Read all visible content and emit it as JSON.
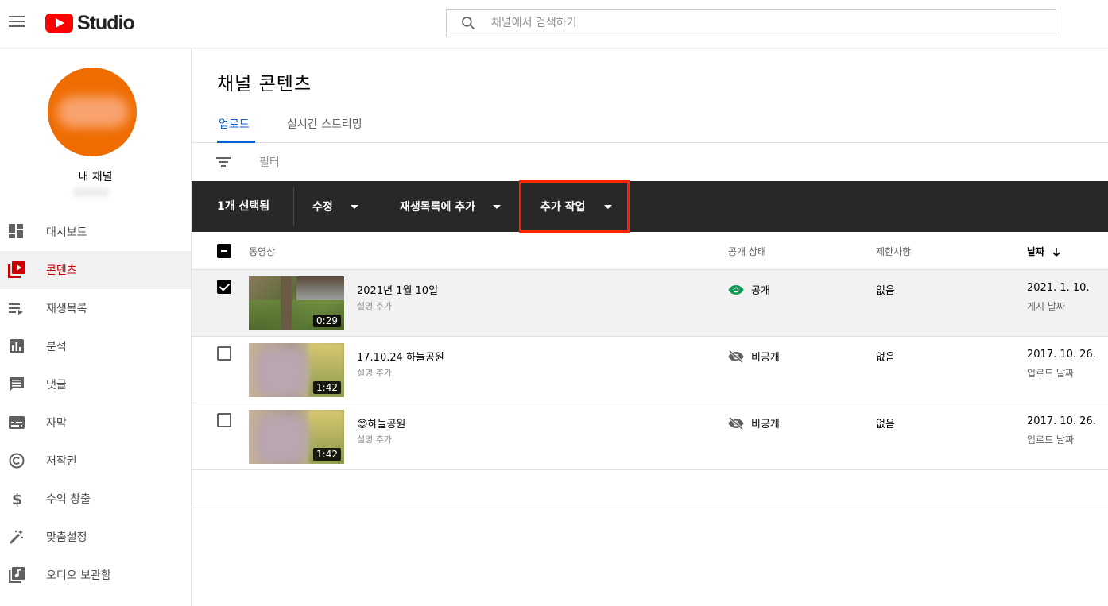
{
  "header": {
    "logo_text": "Studio",
    "search_placeholder": "채널에서 검색하기"
  },
  "sidebar": {
    "channel_label": "내 채널",
    "items": [
      {
        "label": "대시보드",
        "icon": "dashboard-icon"
      },
      {
        "label": "콘텐츠",
        "icon": "content-icon",
        "active": true
      },
      {
        "label": "재생목록",
        "icon": "playlist-icon"
      },
      {
        "label": "분석",
        "icon": "analytics-icon"
      },
      {
        "label": "댓글",
        "icon": "comments-icon"
      },
      {
        "label": "자막",
        "icon": "subtitles-icon"
      },
      {
        "label": "저작권",
        "icon": "copyright-icon"
      },
      {
        "label": "수익 창출",
        "icon": "dollar-icon"
      },
      {
        "label": "맞춤설정",
        "icon": "magic-wand-icon"
      },
      {
        "label": "오디오 보관함",
        "icon": "audio-library-icon"
      }
    ]
  },
  "main": {
    "title": "채널 콘텐츠",
    "tabs": [
      {
        "label": "업로드",
        "active": true
      },
      {
        "label": "실시간 스트리밍"
      }
    ],
    "filter_label": "필터",
    "action_bar": {
      "selected": "1개 선택됨",
      "edit": "수정",
      "add_to_playlist": "재생목록에 추가",
      "more_actions": "추가 작업"
    },
    "columns": {
      "video": "동영상",
      "visibility": "공개 상태",
      "restrictions": "제한사항",
      "date": "날짜"
    },
    "rows": [
      {
        "title": "2021년 1월 10일",
        "description": "설명 추가",
        "duration": "0:29",
        "visibility": "공개",
        "visibility_icon": "eye-icon",
        "restrictions": "없음",
        "date": "2021. 1. 10.",
        "date_type": "게시 날짜",
        "selected": true
      },
      {
        "title": "17.10.24 하늘공원",
        "description": "설명 추가",
        "duration": "1:42",
        "visibility": "비공개",
        "visibility_icon": "eye-off-icon",
        "restrictions": "없음",
        "date": "2017. 10. 26.",
        "date_type": "업로드 날짜",
        "selected": false
      },
      {
        "title": "😊하늘공원",
        "description": "설명 추가",
        "duration": "1:42",
        "visibility": "비공개",
        "visibility_icon": "eye-off-icon",
        "restrictions": "없음",
        "date": "2017. 10. 26.",
        "date_type": "업로드 날짜",
        "selected": false
      }
    ]
  },
  "colors": {
    "accent_blue": "#065fd4",
    "active_red": "#cc0000",
    "public_green": "#0f9d58",
    "action_bar": "#282828",
    "highlight_box": "#ff2200"
  }
}
